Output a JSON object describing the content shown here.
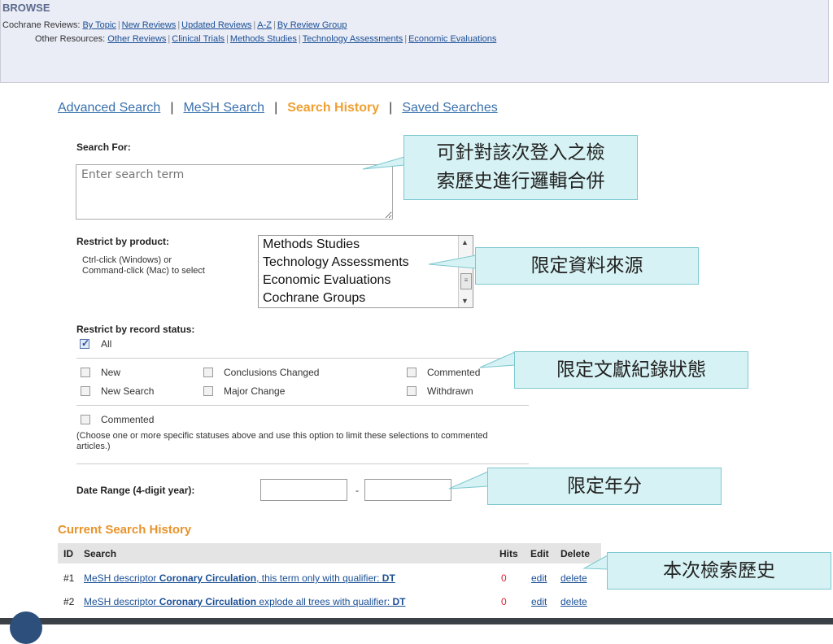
{
  "browse": {
    "title": "BROWSE",
    "reviews_label": "Cochrane Reviews:",
    "reviews_links": [
      "By Topic",
      "New Reviews",
      "Updated Reviews",
      "A-Z",
      "By Review Group"
    ],
    "resources_label": "Other Resources:",
    "resources_links": [
      "Other Reviews",
      "Clinical Trials",
      "Methods Studies",
      "Technology Assessments",
      "Economic Evaluations"
    ]
  },
  "tabs": {
    "advanced": "Advanced Search",
    "mesh": "MeSH Search",
    "history": "Search History",
    "saved": "Saved Searches",
    "sep": "|"
  },
  "search": {
    "label": "Search For:",
    "placeholder": "Enter search term"
  },
  "product": {
    "label": "Restrict by product:",
    "hint": "Ctrl-click (Windows) or Command-click (Mac) to select",
    "options": [
      "Methods Studies",
      "Technology Assessments",
      "Economic Evaluations",
      "Cochrane Groups"
    ]
  },
  "status": {
    "label": "Restrict by record status:",
    "all": "All",
    "options": [
      "New",
      "Conclusions Changed",
      "Commented",
      "New Search",
      "Major Change",
      "Withdrawn"
    ],
    "commented": "Commented",
    "note": "(Choose one or more specific statuses above and use this option to limit these selections to commented articles.)"
  },
  "date": {
    "label": "Date Range (4-digit year):",
    "dash": "-"
  },
  "history": {
    "title": "Current Search History",
    "headers": {
      "id": "ID",
      "search": "Search",
      "hits": "Hits",
      "edit": "Edit",
      "delete": "Delete"
    },
    "rows": [
      {
        "id": "#1",
        "pre": "MeSH descriptor ",
        "term": "Coronary Circulation",
        "mid": ", this term only with qualifier: ",
        "qual": "DT",
        "hits": "0",
        "edit": "edit",
        "delete": "delete"
      },
      {
        "id": "#2",
        "pre": "MeSH descriptor ",
        "term": "Coronary Circulation",
        "mid": " explode all trees with qualifier: ",
        "qual": "DT",
        "hits": "0",
        "edit": "edit",
        "delete": "delete"
      }
    ]
  },
  "callouts": {
    "combine_line1": "可針對該次登入之檢",
    "combine_line2": "索歷史進行邏輯合併",
    "source": "限定資料來源",
    "status": "限定文獻紀錄狀態",
    "year": "限定年分",
    "history": "本次檢索歷史"
  },
  "colors": {
    "browse_bg": "#eaecf6",
    "link": "#1a4f95",
    "active_tab": "#f0a030",
    "history_title": "#e8932b",
    "callout_bg": "#d7f2f4",
    "hits": "#dd2233"
  }
}
